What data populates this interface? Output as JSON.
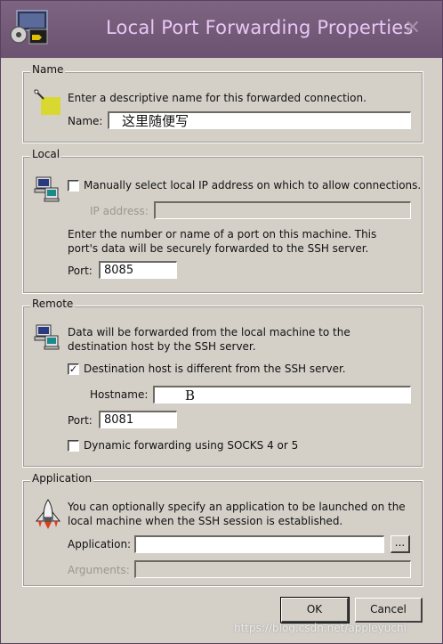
{
  "window": {
    "title": "Local Port Forwarding Properties",
    "close_glyph": "✕"
  },
  "name_section": {
    "legend": "Name",
    "description": "Enter a descriptive name for this forwarded connection.",
    "name_label": "Name:",
    "name_value": "这里随便写",
    "icon": "tag-icon"
  },
  "local_section": {
    "legend": "Local",
    "manual_ip_label": "Manually select local IP address on which to allow connections.",
    "manual_ip_checked": false,
    "ip_label": "IP address:",
    "ip_value": "",
    "port_hint": "Enter the number or name of a port on this machine.  This port's data will be securely forwarded to the SSH server.",
    "port_label": "Port:",
    "port_value": "8085",
    "icon": "computer-icon"
  },
  "remote_section": {
    "legend": "Remote",
    "description": "Data will be forwarded from the local machine to the destination host by the SSH server.",
    "dest_diff_label": "Destination host is different from the SSH server.",
    "dest_diff_checked": true,
    "hostname_label": "Hostname:",
    "hostname_value": "B",
    "port_label": "Port:",
    "port_value": "8081",
    "dynamic_label": "Dynamic forwarding using SOCKS 4 or 5",
    "dynamic_checked": false,
    "icon": "computer-icon"
  },
  "application_section": {
    "legend": "Application",
    "description": "You can optionally specify an application to be launched on the local machine when the SSH session is established.",
    "application_label": "Application:",
    "application_value": "",
    "browse_label": "...",
    "arguments_label": "Arguments:",
    "arguments_value": "",
    "icon": "space-shuttle-icon"
  },
  "buttons": {
    "ok": "OK",
    "cancel": "Cancel"
  },
  "watermark": "https://blog.csdn.net/appleyuchi",
  "colors": {
    "titlebar": "#6b5270",
    "title_text": "#e9c6f5",
    "dialog_bg": "#d4d0c8"
  }
}
